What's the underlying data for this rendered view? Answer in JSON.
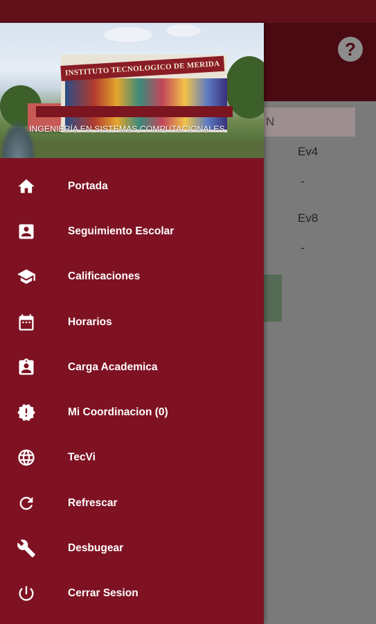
{
  "app": {
    "statusbar_color": "#62101a",
    "drawer_color": "#7e1222"
  },
  "header": {
    "sign_text": "INSTITUTO TECNOLOGICO DE MERIDA",
    "subtitle": "INGENIERÍA EN SISTEMAS COMPUTACIONALES"
  },
  "menu": {
    "items": [
      {
        "label": "Portada",
        "icon": "home-icon"
      },
      {
        "label": "Seguimiento Escolar",
        "icon": "account-box-icon"
      },
      {
        "label": "Calificaciones",
        "icon": "school-icon"
      },
      {
        "label": "Horarios",
        "icon": "calendar-icon"
      },
      {
        "label": "Carga Academica",
        "icon": "assignment-ind-icon"
      },
      {
        "label": "Mi Coordinacion (0)",
        "icon": "alert-badge-icon"
      },
      {
        "label": "TecVi",
        "icon": "globe-icon"
      },
      {
        "label": "Refrescar",
        "icon": "refresh-icon"
      },
      {
        "label": "Desbugear",
        "icon": "wrench-icon"
      },
      {
        "label": "Cerrar Sesion",
        "icon": "power-icon"
      }
    ]
  },
  "background": {
    "help_symbol": "?",
    "field_fragment": "N",
    "col1_header": "Ev4",
    "col1_value": "-",
    "col2_header": "Ev8",
    "col2_value": "-"
  }
}
